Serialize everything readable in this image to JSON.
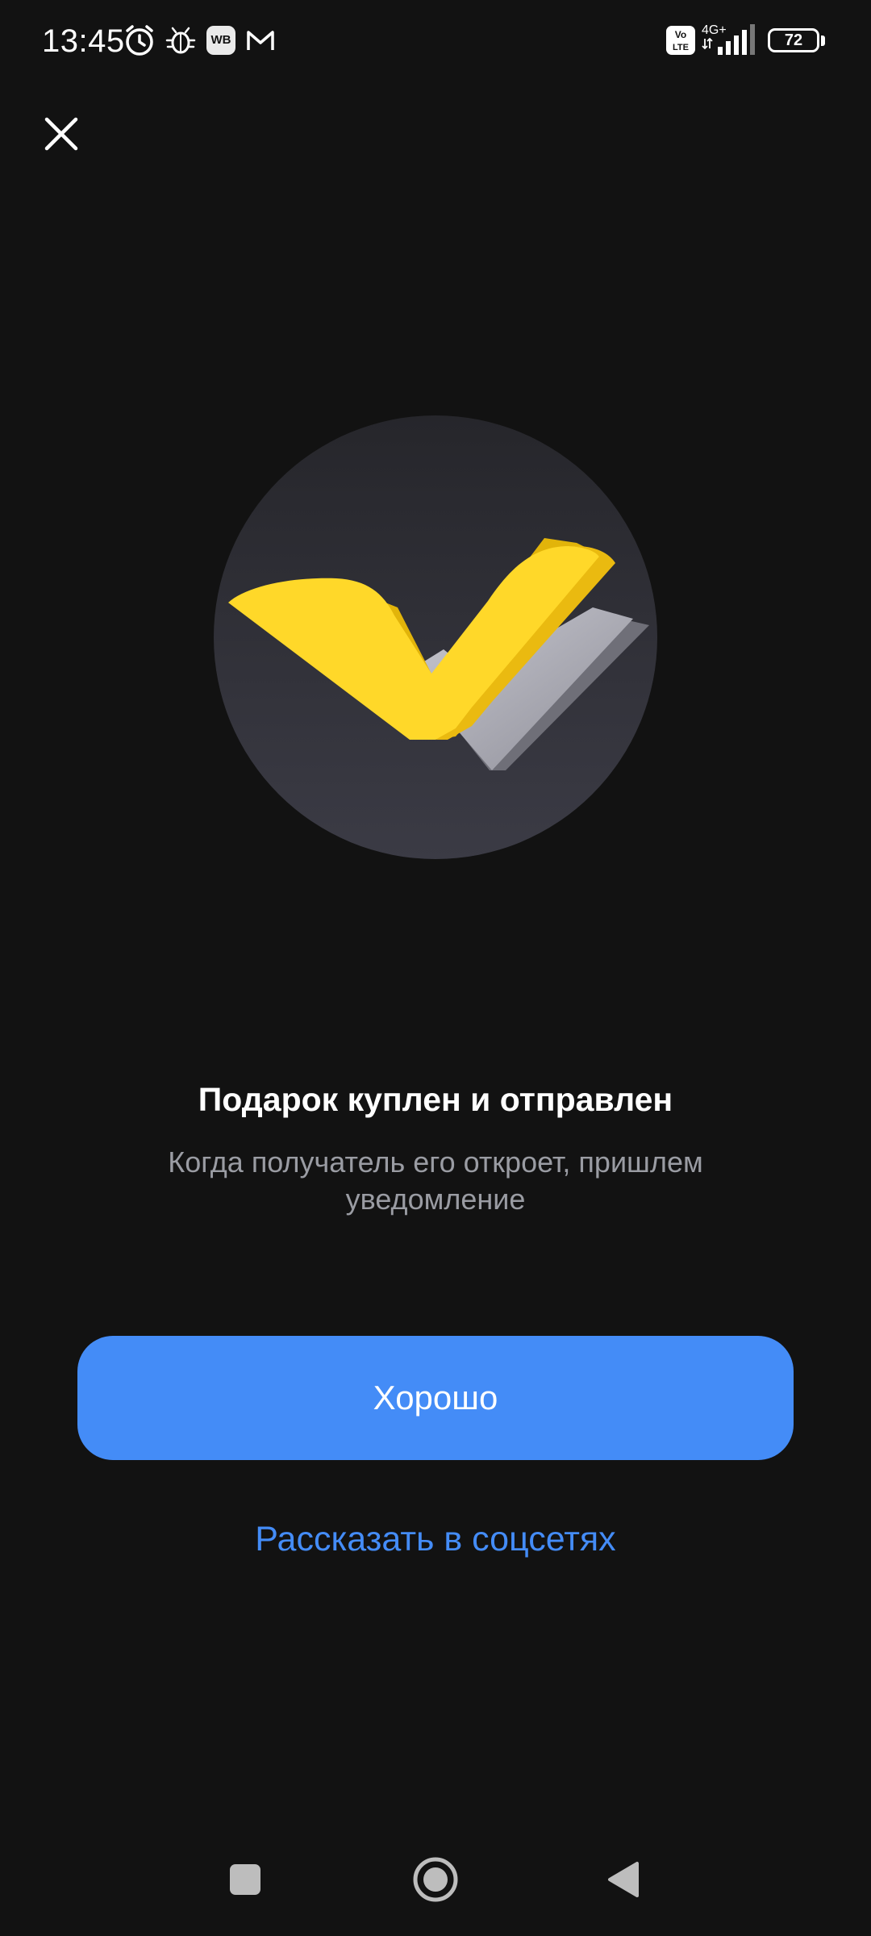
{
  "status_bar": {
    "time": "13:45",
    "wb_label": "WB",
    "battery_level": "72",
    "network_label": "4G+",
    "volte_label": "Vo LTE",
    "icons": [
      "alarm-icon",
      "bug-icon",
      "wb-app-icon",
      "gmail-icon",
      "volte-icon",
      "signal-icon",
      "battery-icon"
    ]
  },
  "dialog": {
    "close_icon": "close-icon",
    "title": "Подарок куплен и отправлен",
    "subtitle": "Когда получатель его откроет, пришлем уведомление",
    "primary_button": "Хорошо",
    "share_link": "Рассказать в соцсетях"
  },
  "colors": {
    "background": "#121212",
    "accent": "#448cf7",
    "check_primary": "#ffd829",
    "check_secondary": "#a9a9b2",
    "circle": "#2c2c33",
    "subtitle": "#9a9ca3"
  },
  "nav_bar": {
    "icons": [
      "recents-icon",
      "home-icon",
      "back-icon"
    ]
  }
}
